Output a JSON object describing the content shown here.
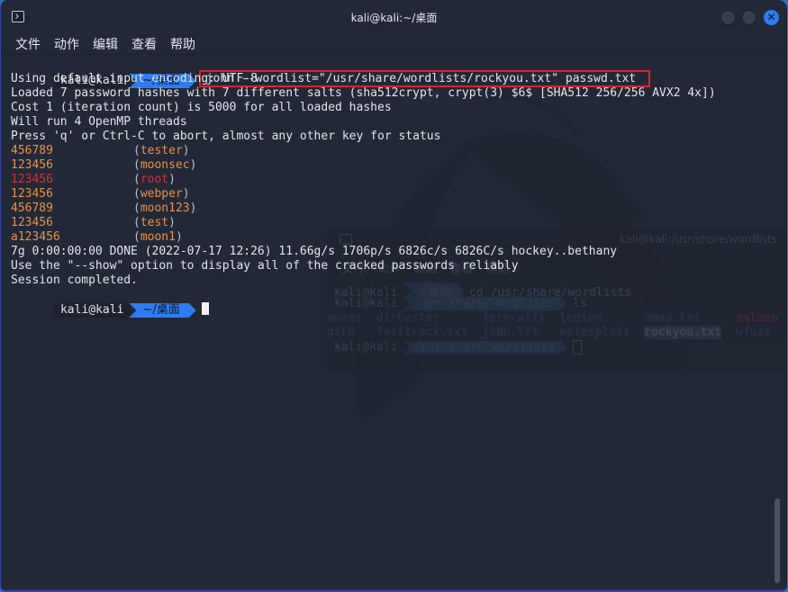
{
  "window": {
    "title": "kali@kali:~/桌面",
    "icon": "terminal-icon",
    "controls": {
      "minimize": "minimize-button",
      "maximize": "maximize-button",
      "close": "close-button",
      "close_glyph": "✕"
    }
  },
  "menu": [
    "文件",
    "动作",
    "编辑",
    "查看",
    "帮助"
  ],
  "prompt": {
    "user": "kali@kali",
    "dir": "~/桌面"
  },
  "command": "john --wordlist=\"/usr/share/wordlists/rockyou.txt\" passwd.txt",
  "output": [
    "Using default input encoding: UTF-8",
    "Loaded 7 password hashes with 7 different salts (sha512crypt, crypt(3) $6$ [SHA512 256/256 AVX2 4x])",
    "Cost 1 (iteration count) is 5000 for all loaded hashes",
    "Will run 4 OpenMP threads",
    "Press 'q' or Ctrl-C to abort, almost any other key for status"
  ],
  "cracked": [
    {
      "password": "456789",
      "user": "tester",
      "highlight": false
    },
    {
      "password": "123456",
      "user": "moonsec",
      "highlight": false
    },
    {
      "password": "123456",
      "user": "root",
      "highlight": true
    },
    {
      "password": "123456",
      "user": "webper",
      "highlight": false
    },
    {
      "password": "456789",
      "user": "moon123",
      "highlight": false
    },
    {
      "password": "123456",
      "user": "test",
      "highlight": false
    },
    {
      "password": "a123456",
      "user": "moon1",
      "highlight": false
    }
  ],
  "summary": [
    "7g 0:00:00:00 DONE (2022-07-17 12:26) 11.66g/s 1706p/s 6826c/s 6826C/s hockey..bethany",
    "Use the \"--show\" option to display all of the cracked passwords reliably",
    "Session completed."
  ],
  "colors": {
    "background": "#232836",
    "prompt_dir_bg": "#2f7cf0",
    "password": "#e8914a",
    "root_highlight": "#d3313a",
    "annotation_box": "#e0202a"
  },
  "background_window": {
    "title": "kali@kali:/usr/share/wordlists",
    "menu": "文件 动作 编辑 查看 帮助",
    "lines": [
      {
        "user": "kali@kali",
        "dir": "~/桌面",
        "cmd": "cd /usr/share/wordlists"
      },
      {
        "user": "kali@kali",
        "dir": "/usr/share/wordlists",
        "cmd": "ls"
      }
    ],
    "listing_row1": [
      "amass",
      "dirbuster",
      "fern-wifi",
      "legion",
      "nmap.lst",
      "sqlmap"
    ],
    "listing_row2": [
      "dirb",
      "fasttrack.txt",
      "john.lst",
      "metasploit",
      "rockyou.txt",
      "wfuzz"
    ],
    "last_prompt": {
      "user": "kali@kali",
      "dir": "/usr/share/wordlists"
    }
  }
}
